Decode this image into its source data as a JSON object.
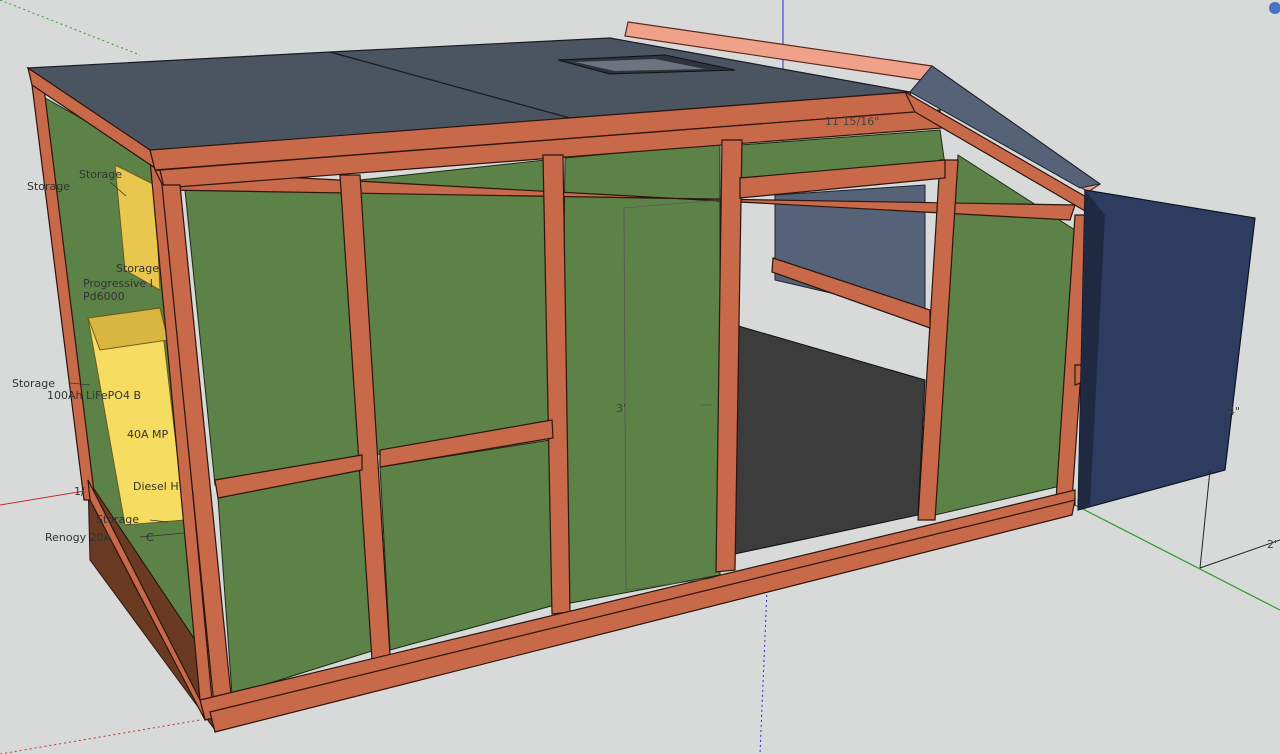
{
  "model_labels": {
    "storage_top": "Storage",
    "storage_left": "Storage",
    "storage_mid": "Storage",
    "storage_lower": "Storage",
    "storage_bottom": "Storage",
    "charger_line1": "Progressive I",
    "charger_line2": "Pd6000",
    "battery": "100Ah LiFePO4 B",
    "mppt": "40A MP",
    "diesel": "Diesel H",
    "dcdc": "Renogy 20A",
    "dcdc_tail": "C",
    "fraction": "1/"
  },
  "dimensions": {
    "rafter": "11 15/16\"",
    "door_height": "3'",
    "side_depth": "4\"",
    "axis_length": "2'"
  },
  "colors": {
    "background": "#d8d9d9",
    "framing": "#c8694a",
    "sheathing": "#5c8247",
    "roof": "#4b5461",
    "storage_box": "#f2d660",
    "hatch_box": "#2d3c5f",
    "axis_red": "#c23030",
    "axis_green": "#2aa02a",
    "axis_blue": "#2b2bd8"
  }
}
